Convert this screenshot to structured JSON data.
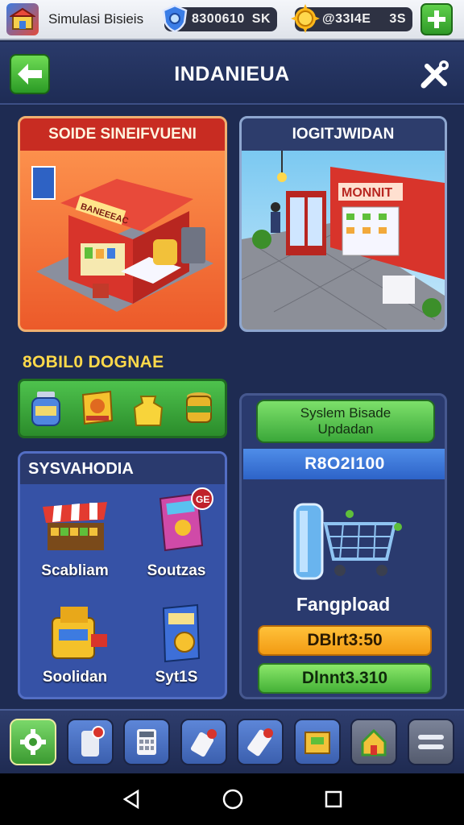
{
  "topbar": {
    "app_title": "Simulasi Bisieis",
    "currency_1": {
      "amount": "8300610",
      "suffix": "SK",
      "icon": "shield-gem-icon"
    },
    "currency_2": {
      "amount": "@33I4E",
      "suffix": "3S",
      "icon": "gold-coin-icon"
    },
    "plus_icon": "plus-icon"
  },
  "header": {
    "title": "INDANIEUA",
    "back_icon": "arrow-left-icon",
    "tools_icon": "tools-icon"
  },
  "cards": {
    "store": {
      "title": "SOIDE SINEIFVUENI",
      "sign": "BANEEEAC"
    },
    "logistics": {
      "title": "IOGITJWIDAN",
      "sign": "MONNIT"
    }
  },
  "stock": {
    "label": "8OBIL0 DOGNAE",
    "items": [
      "jar-icon",
      "snack-box-icon",
      "bag-icon",
      "pot-icon"
    ]
  },
  "systems": {
    "title": "SYSVAHODIA",
    "items": [
      {
        "label": "Scabliam",
        "icon": "market-stall-icon"
      },
      {
        "label": "Soutzas",
        "icon": "book-icon",
        "badge": "GE"
      },
      {
        "label": "Soolidan",
        "icon": "register-icon"
      },
      {
        "label": "Syt1S",
        "icon": "coin-book-icon"
      }
    ]
  },
  "upgrade": {
    "button_line1": "Syslem Bisade",
    "button_line2": "Updadan",
    "code": "R8O2I100",
    "item_name": "Fangpload",
    "price_orange": "DBlrt3:50",
    "price_green": "Dlnnt3.310"
  },
  "bottombar": [
    "gear-icon",
    "phone-icon",
    "calculator-icon",
    "card-icon",
    "phone-card-icon",
    "inventory-icon",
    "home-icon",
    "menu-icon"
  ],
  "navbar": [
    "back-triangle-icon",
    "home-circle-icon",
    "recent-square-icon"
  ],
  "colors": {
    "accent_green": "#3ba83a",
    "panel_blue": "#2a3a6e",
    "store_orange": "#ec5a2a",
    "title_red": "#c82c22",
    "gold": "#ffd94a"
  }
}
